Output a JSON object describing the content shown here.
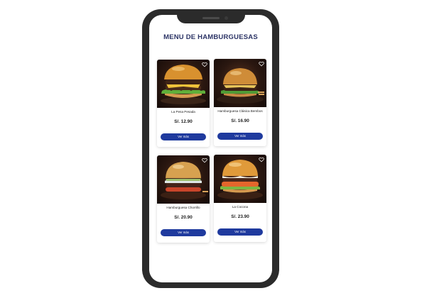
{
  "page": {
    "title": "MENU DE HAMBURGUESAS"
  },
  "colors": {
    "title": "#2c3466",
    "button": "#1f3a9e",
    "phone_frame": "#2b2b2b"
  },
  "products": [
    {
      "name": "La Pesa Pesada",
      "price": "S/. 12.90",
      "button_label": "Ver más",
      "icon": "heart-icon"
    },
    {
      "name": "Hamburguesa Clásica Bembos",
      "price": "S/. 16.90",
      "button_label": "Ver más",
      "icon": "heart-icon"
    },
    {
      "name": "Hamburguesa Chorrillo",
      "price": "S/. 20.90",
      "button_label": "Ver más",
      "icon": "heart-icon"
    },
    {
      "name": "La Cocona",
      "price": "S/. 23.90",
      "button_label": "Ver más",
      "icon": "heart-icon"
    }
  ]
}
